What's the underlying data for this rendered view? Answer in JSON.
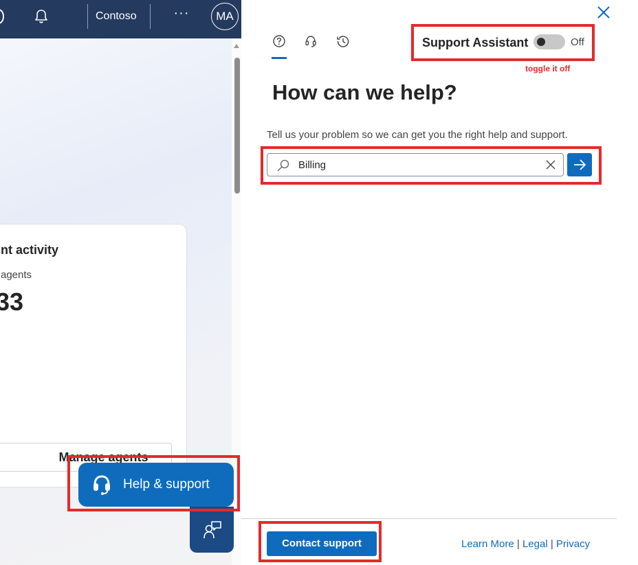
{
  "topbar": {
    "org_name": "Contoso",
    "more_label": "···",
    "avatar_initials": "MA"
  },
  "card": {
    "title": "nt activity",
    "subtitle": "agents",
    "count": "33",
    "manage_button": "Manage agents"
  },
  "help_fab": {
    "label": "Help & support"
  },
  "panel": {
    "tabs": [
      {
        "icon": "help-circle-icon"
      },
      {
        "icon": "headset-icon"
      },
      {
        "icon": "history-icon"
      }
    ],
    "support_assistant_label": "Support Assistant",
    "toggle_state": "Off",
    "annotation": "toggle it off",
    "heading": "How can we help?",
    "description": "Tell us your problem so we can get you the right help and support.",
    "search": {
      "value": "Billing"
    },
    "contact_button": "Contact support",
    "footer": {
      "learn_more": "Learn More",
      "legal": "Legal",
      "privacy": "Privacy",
      "separator": "|"
    }
  },
  "colors": {
    "topbar_bg": "#243a5e",
    "accent": "#0f6cbd",
    "highlight": "#e32a2a"
  }
}
